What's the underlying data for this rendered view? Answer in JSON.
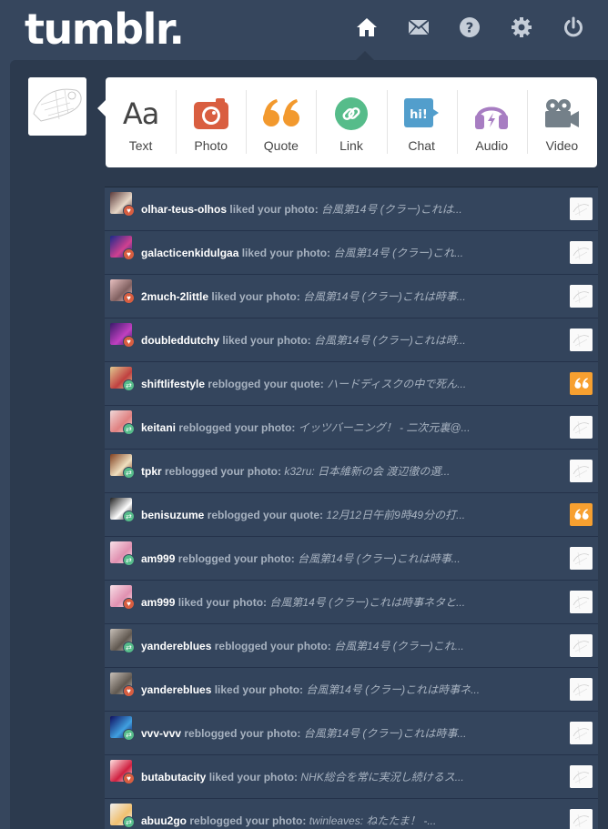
{
  "header": {
    "logo": "tumblr.",
    "nav": [
      {
        "name": "home-icon"
      },
      {
        "name": "mail-icon"
      },
      {
        "name": "help-icon"
      },
      {
        "name": "settings-icon"
      },
      {
        "name": "power-icon"
      }
    ]
  },
  "post_types": [
    {
      "label": "Text",
      "icon": "text-icon",
      "color": "#444444"
    },
    {
      "label": "Photo",
      "icon": "camera-icon",
      "color": "#d95e40"
    },
    {
      "label": "Quote",
      "icon": "quote-icon",
      "color": "#f2992e"
    },
    {
      "label": "Link",
      "icon": "link-icon",
      "color": "#56bc8a"
    },
    {
      "label": "Chat",
      "icon": "chat-icon",
      "color": "#529ecc"
    },
    {
      "label": "Audio",
      "icon": "headphones-icon",
      "color": "#a77dc2"
    },
    {
      "label": "Video",
      "icon": "video-camera-icon",
      "color": "#748089"
    }
  ],
  "activity": [
    {
      "user": "olhar-teus-olhos",
      "action": "liked your photo:",
      "summary": "台風第14号 (クラー)これは...",
      "type": "like",
      "thumb": "photo"
    },
    {
      "user": "galacticenkidulgaa",
      "action": "liked your photo:",
      "summary": "台風第14号 (クラー)これ...",
      "type": "like",
      "thumb": "photo"
    },
    {
      "user": "2much-2little",
      "action": "liked your photo:",
      "summary": "台風第14号 (クラー)これは時事...",
      "type": "like",
      "thumb": "photo"
    },
    {
      "user": "doubleddutchy",
      "action": "liked your photo:",
      "summary": "台風第14号 (クラー)これは時...",
      "type": "like",
      "thumb": "photo"
    },
    {
      "user": "shiftlifestyle",
      "action": "reblogged your quote:",
      "summary": "ハードディスクの中で死ん...",
      "type": "reblog",
      "thumb": "quote"
    },
    {
      "user": "keitani",
      "action": "reblogged your photo:",
      "summary": "イッツバーニング！ - 二次元裏@...",
      "type": "reblog",
      "thumb": "photo"
    },
    {
      "user": "tpkr",
      "action": "reblogged your photo:",
      "summary": "k32ru: 日本維新の会 渡辺徹の選...",
      "type": "reblog",
      "thumb": "photo"
    },
    {
      "user": "benisuzume",
      "action": "reblogged your quote:",
      "summary": "12月12日午前9時49分の打...",
      "type": "reblog",
      "thumb": "quote"
    },
    {
      "user": "am999",
      "action": "reblogged your photo:",
      "summary": "台風第14号 (クラー)これは時事...",
      "type": "reblog",
      "thumb": "photo"
    },
    {
      "user": "am999",
      "action": "liked your photo:",
      "summary": "台風第14号 (クラー)これは時事ネタと...",
      "type": "like",
      "thumb": "photo"
    },
    {
      "user": "yandereblues",
      "action": "reblogged your photo:",
      "summary": "台風第14号 (クラー)これ...",
      "type": "reblog",
      "thumb": "photo"
    },
    {
      "user": "yandereblues",
      "action": "liked your photo:",
      "summary": "台風第14号 (クラー)これは時事ネ...",
      "type": "like",
      "thumb": "photo"
    },
    {
      "user": "vvv-vvv",
      "action": "reblogged your photo:",
      "summary": "台風第14号 (クラー)これは時事...",
      "type": "reblog",
      "thumb": "photo"
    },
    {
      "user": "butabutacity",
      "action": "liked your photo:",
      "summary": "NHK総合を常に実況し続けるス...",
      "type": "like",
      "thumb": "photo"
    },
    {
      "user": "abuu2go",
      "action": "reblogged your photo:",
      "summary": "twinleaves: ねたたま！ -...",
      "type": "reblog",
      "thumb": "photo"
    }
  ],
  "colors": {
    "background": "#36465d",
    "panel": "#2c3a4e",
    "like_badge": "#d95e40",
    "reblog_badge": "#56bc8a",
    "quote_thumb": "#f7a030"
  }
}
